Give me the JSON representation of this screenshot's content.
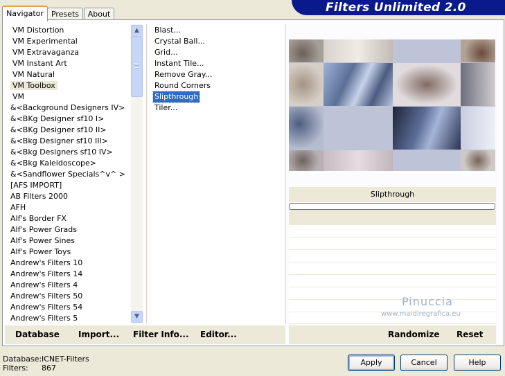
{
  "tabs": [
    {
      "label": "Navigator",
      "active": true
    },
    {
      "label": "Presets",
      "active": false
    },
    {
      "label": "About",
      "active": false
    }
  ],
  "banner": {
    "title": "Filters Unlimited 2.0",
    "color": "#0a1a8c"
  },
  "categories": [
    "VM Distortion",
    "VM Experimental",
    "VM Extravaganza",
    "VM Instant Art",
    "VM Natural",
    "VM Toolbox",
    "VM",
    "&<Background Designers IV>",
    "&<BKg Designer sf10 I>",
    "&<BKg Designer sf10 II>",
    "&<Bkg Designer sf10 III>",
    "&<Bkg Designers sf10 IV>",
    "&<Bkg Kaleidoscope>",
    "&<Sandflower Specials^v^ >",
    "[AFS IMPORT]",
    "AB Filters 2000",
    "AFH",
    "Alf's Border FX",
    "Alf's Power Grads",
    "Alf's Power Sines",
    "Alf's Power Toys",
    "Andrew's Filters 10",
    "Andrew's Filters 14",
    "Andrew's Filters 4",
    "Andrew's Filters 50",
    "Andrew's Filters 54",
    "Andrew's Filters 5"
  ],
  "selected_category": "VM Toolbox",
  "filters": [
    "Blast...",
    "Crystal Ball...",
    "Grid...",
    "Instant Tile...",
    "Remove Gray...",
    "Round Corners",
    "Slipthrough",
    "Tiler..."
  ],
  "selected_filter": "Slipthrough",
  "preview": {
    "filter_name": "Slipthrough"
  },
  "watermark": {
    "line1": "Pinuccia",
    "line2": "www.maidiregrafica.eu"
  },
  "links": {
    "database": "Database",
    "import": "Import...",
    "filter_info": "Filter Info...",
    "editor": "Editor...",
    "randomize": "Randomize",
    "reset": "Reset"
  },
  "footer": {
    "database_label": "Database:",
    "database_value": "ICNET-Filters",
    "filters_label": "Filters:",
    "filters_value": "867"
  },
  "buttons": {
    "apply": "Apply",
    "cancel": "Cancel",
    "help": "Help"
  },
  "colors": {
    "selection": "#316ac5",
    "dialog_bg": "#ece9d8",
    "tab_highlight": "#e6a43c"
  }
}
